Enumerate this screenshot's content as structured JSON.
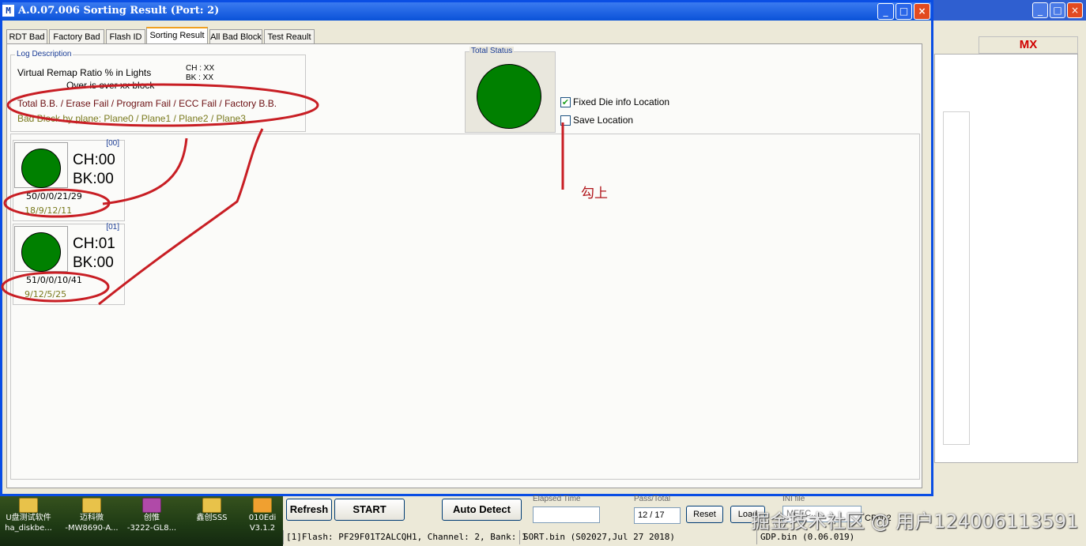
{
  "window": {
    "title": "A.0.07.006 Sorting Result (Port: 2)",
    "app_icon": "M",
    "controls": {
      "minimize": "_",
      "maximize": "□",
      "close": "×"
    }
  },
  "background_app": {
    "controls": {
      "minimize": "_",
      "maximize": "□",
      "close": "×"
    },
    "mx_label": "MX"
  },
  "tabs": [
    {
      "label": "RDT Bad"
    },
    {
      "label": "Factory Bad"
    },
    {
      "label": "Flash ID"
    },
    {
      "label": "Sorting Result",
      "active": true
    },
    {
      "label": "All Bad Block"
    },
    {
      "label": "Test Reault"
    }
  ],
  "log_description": {
    "legend": "Log Description",
    "remap_label": "Virtual Remap Ratio % in Lights",
    "over_label": "Over is over xx block",
    "ch_label": "CH : XX",
    "bk_label": "BK : XX",
    "bb_line": "Total B.B. / Erase Fail / Program Fail / ECC Fail / Factory B.B.",
    "plane_line": "Bad Block by plane: Plane0 / Plane1 / Plane2 / Plane3"
  },
  "total_status": {
    "legend": "Total Status",
    "color": "#008000"
  },
  "options": {
    "fixed_die": {
      "label": "Fixed Die info Location",
      "checked": true,
      "mark": "✔"
    },
    "save_location": {
      "label": "Save Location",
      "checked": false
    }
  },
  "annotation": {
    "text": "勾上",
    "color": "#b0151b"
  },
  "dies": [
    {
      "index": "[00]",
      "ch": "CH:00",
      "bk": "BK:00",
      "bb": "50/0/0/21/29",
      "planes": "18/9/12/11",
      "color": "#008000"
    },
    {
      "index": "[01]",
      "ch": "CH:01",
      "bk": "BK:00",
      "bb": "51/0/0/10/41",
      "planes": "9/12/5/25",
      "color": "#008000"
    }
  ],
  "desktop_icons": [
    {
      "line1": "U盘测试软件",
      "line2": "ha_diskbe..."
    },
    {
      "line1": "迈科微",
      "line2": "-MW8690-A..."
    },
    {
      "line1": "创惟",
      "line2": "-3222-GL8..."
    },
    {
      "line1": "鑫创SSS",
      "line2": ""
    },
    {
      "line1": "010Edi",
      "line2": "V3.1.2"
    }
  ],
  "bottom": {
    "refresh": "Refresh",
    "start": "START",
    "auto_detect": "Auto Detect",
    "elapsed_label": "Elapsed Time",
    "elapsed_value": "",
    "pass_total_label": "Pass/Total",
    "pass_total_value": "12 / 17",
    "reset": "Reset",
    "load": "Load",
    "ini_label": "INI file",
    "ini_value": "MFEC...",
    "extra": "CP002"
  },
  "status_bar": {
    "flash": "[1]Flash: PF29F01T2ALCQH1, Channel: 2, Bank: 1",
    "sort": "SORT.bin (S02027,Jul 27 2018)",
    "gdp": "GDP.bin (0.06.019)"
  },
  "watermark": "掘金技术社区 @ 用户124006113591"
}
